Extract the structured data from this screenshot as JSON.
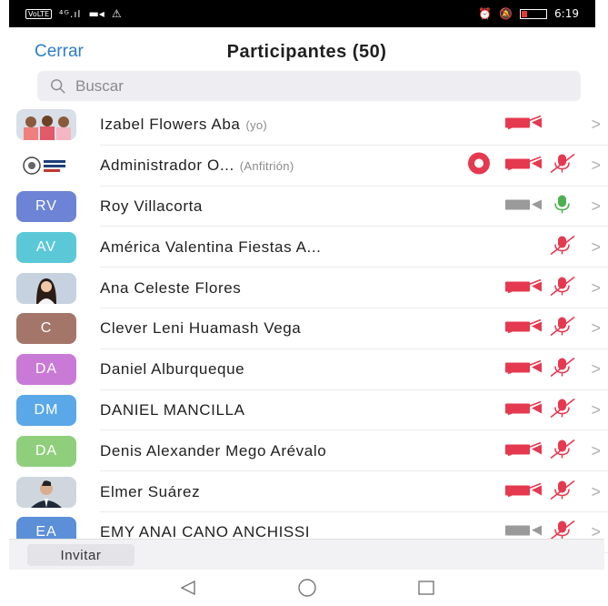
{
  "status_bar": {
    "network": "VoLTE",
    "signal": "4G",
    "time": "6:19"
  },
  "header": {
    "close_label": "Cerrar",
    "title": "Participantes (50)"
  },
  "search": {
    "placeholder": "Buscar"
  },
  "colors": {
    "accent": "#2e7ec8",
    "muted_red": "#e53950",
    "unmuted_green": "#4caf50",
    "camera_gray": "#9a9a9a"
  },
  "participants": [
    {
      "name": "Izabel Flowers Aba",
      "tag": "(yo)",
      "avatar": "photo",
      "camera": "off",
      "mic": "none",
      "recording": false
    },
    {
      "name": "Administrador O...",
      "tag": "(Anfitrión)",
      "avatar": "logo",
      "camera": "off",
      "mic": "muted",
      "recording": true
    },
    {
      "name": "Roy Villacorta",
      "tag": "",
      "initials": "RV",
      "avatar_color": "#6d84d6",
      "camera": "on",
      "mic": "unmuted",
      "recording": false
    },
    {
      "name": "América Valentina Fiestas A...",
      "tag": "",
      "initials": "AV",
      "avatar_color": "#5bc8d8",
      "camera": "none",
      "mic": "muted",
      "recording": false
    },
    {
      "name": "Ana Celeste Flores",
      "tag": "",
      "avatar": "photo",
      "camera": "off",
      "mic": "muted",
      "recording": false
    },
    {
      "name": "Clever Leni Huamash Vega",
      "tag": "",
      "initials": "C",
      "avatar_color": "#a4766a",
      "camera": "off",
      "mic": "muted",
      "recording": false
    },
    {
      "name": "Daniel Alburqueque",
      "tag": "",
      "initials": "DA",
      "avatar_color": "#c97ad6",
      "camera": "off",
      "mic": "muted",
      "recording": false
    },
    {
      "name": "DANIEL MANCILLA",
      "tag": "",
      "initials": "DM",
      "avatar_color": "#5aa8e8",
      "camera": "off",
      "mic": "muted",
      "recording": false
    },
    {
      "name": "Denis Alexander Mego Arévalo",
      "tag": "",
      "initials": "DA",
      "avatar_color": "#8fcf7c",
      "camera": "off",
      "mic": "muted",
      "recording": false
    },
    {
      "name": "Elmer Suárez",
      "tag": "",
      "avatar": "photo",
      "camera": "off",
      "mic": "muted",
      "recording": false
    },
    {
      "name": "EMY ANAI CANO ANCHISSI",
      "tag": "",
      "initials": "EA",
      "avatar_color": "#5b8fd8",
      "camera": "on",
      "mic": "muted",
      "recording": false
    }
  ],
  "footer": {
    "invite_label": "Invitar"
  }
}
